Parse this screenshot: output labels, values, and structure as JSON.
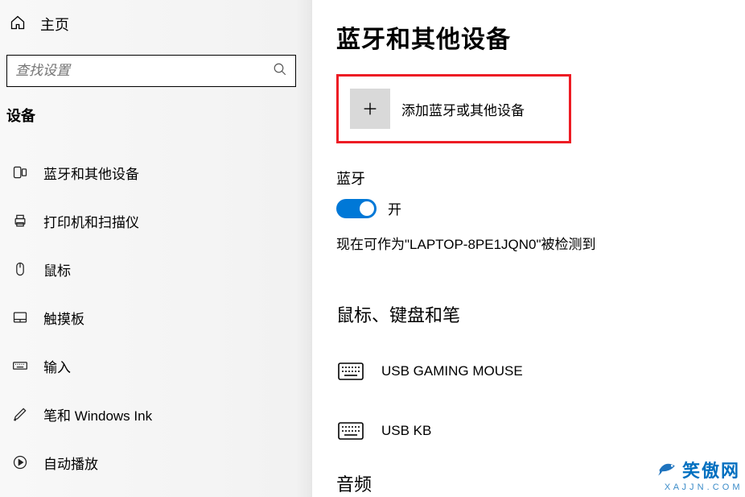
{
  "sidebar": {
    "home": "主页",
    "search_placeholder": "查找设置",
    "section": "设备",
    "items": [
      {
        "label": "蓝牙和其他设备"
      },
      {
        "label": "打印机和扫描仪"
      },
      {
        "label": "鼠标"
      },
      {
        "label": "触摸板"
      },
      {
        "label": "输入"
      },
      {
        "label": "笔和 Windows Ink"
      },
      {
        "label": "自动播放"
      }
    ]
  },
  "main": {
    "title": "蓝牙和其他设备",
    "add_device": "添加蓝牙或其他设备",
    "bluetooth_heading": "蓝牙",
    "toggle_state": "开",
    "detect_text": "现在可作为\"LAPTOP-8PE1JQN0\"被检测到",
    "section_mouse_kbd": "鼠标、键盘和笔",
    "devices": [
      {
        "name": "USB GAMING MOUSE"
      },
      {
        "name": "USB KB"
      }
    ],
    "section_audio": "音频"
  },
  "watermark": {
    "text": "笑傲网",
    "sub": "X A J J N . C O M"
  }
}
